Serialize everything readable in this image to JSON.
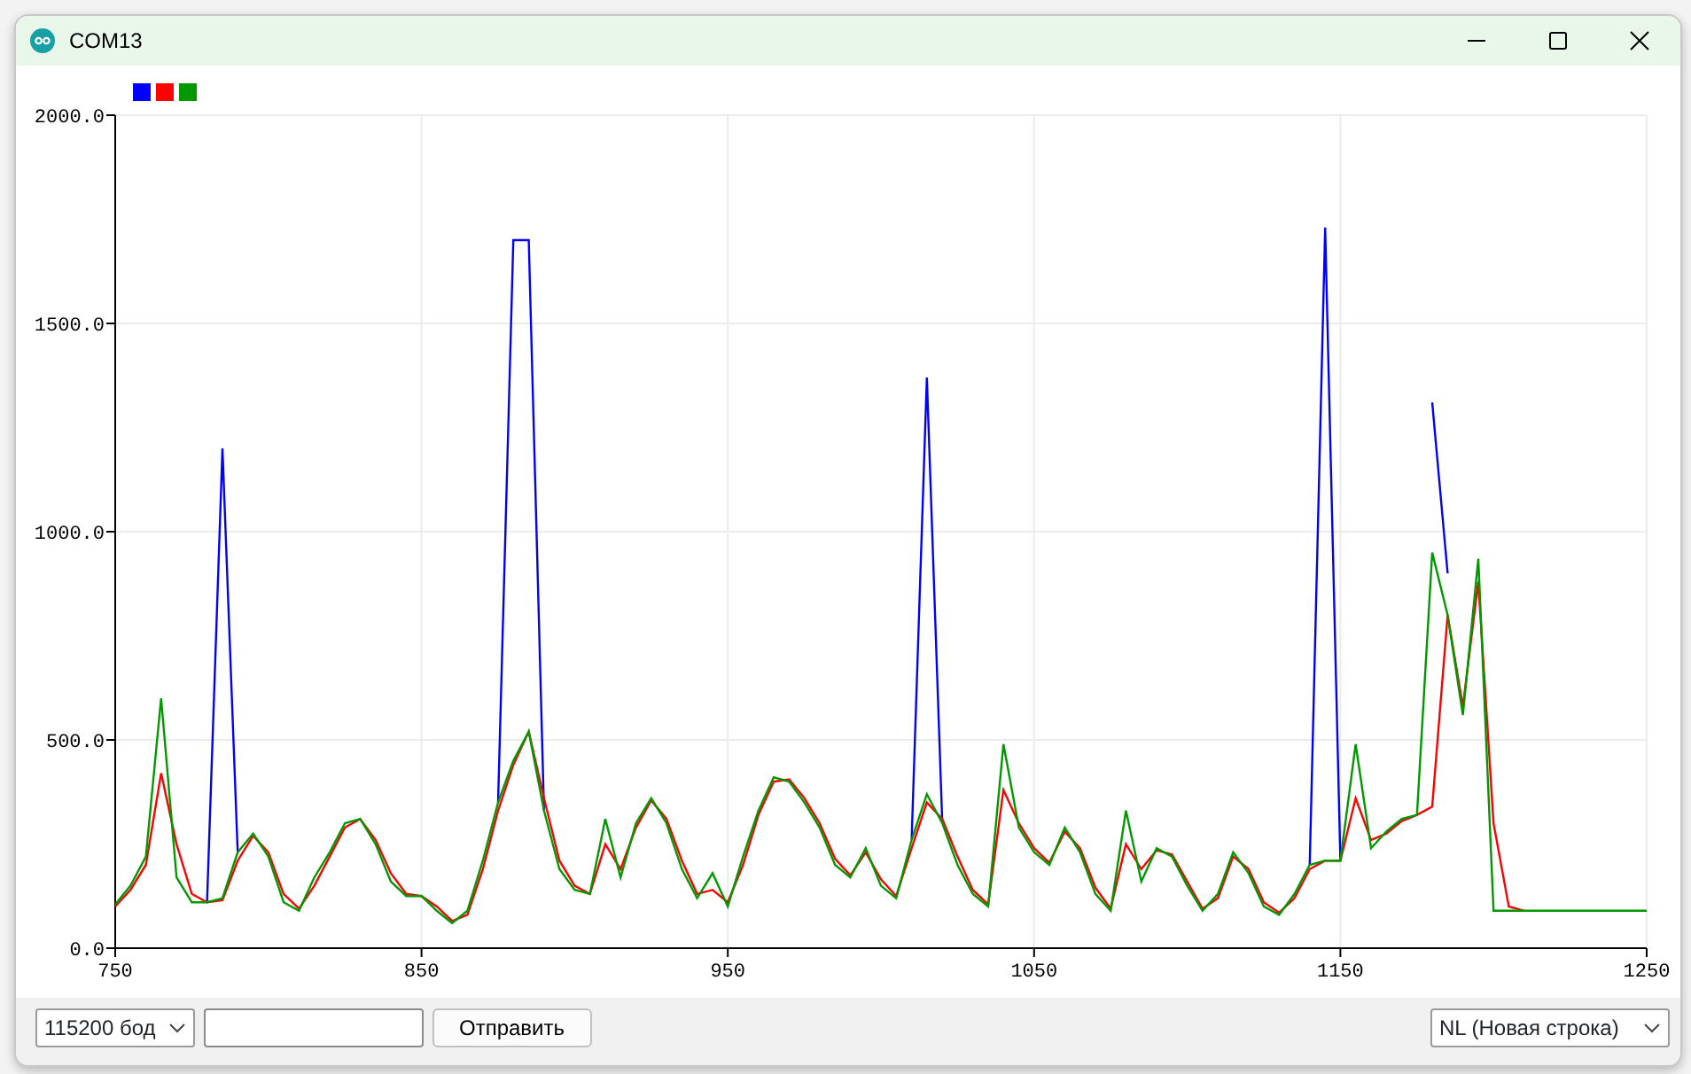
{
  "window": {
    "title": "COM13"
  },
  "plotter": {
    "chart_data": {
      "type": "line",
      "grid": true,
      "xlim": [
        750,
        1250
      ],
      "ylim": [
        0,
        2000
      ],
      "xticks": [
        750,
        850,
        950,
        1050,
        1150,
        1250
      ],
      "yticks": [
        {
          "value": 0,
          "label": "0.0"
        },
        {
          "value": 500,
          "label": "500.0"
        },
        {
          "value": 1000,
          "label": "1000.0"
        },
        {
          "value": 1500,
          "label": "1500.0"
        },
        {
          "value": 2000,
          "label": "2000.0"
        }
      ],
      "x": [
        750,
        755,
        760,
        765,
        770,
        775,
        780,
        785,
        790,
        795,
        800,
        805,
        810,
        815,
        820,
        825,
        830,
        835,
        840,
        845,
        850,
        855,
        860,
        865,
        870,
        875,
        880,
        885,
        890,
        895,
        900,
        905,
        910,
        915,
        920,
        925,
        930,
        935,
        940,
        945,
        950,
        955,
        960,
        965,
        970,
        975,
        980,
        985,
        990,
        995,
        1000,
        1005,
        1010,
        1015,
        1020,
        1025,
        1030,
        1035,
        1040,
        1045,
        1050,
        1055,
        1060,
        1065,
        1070,
        1075,
        1080,
        1085,
        1090,
        1095,
        1100,
        1105,
        1110,
        1115,
        1120,
        1125,
        1130,
        1135,
        1140,
        1145,
        1150,
        1155,
        1160,
        1165,
        1170,
        1175,
        1180,
        1185,
        1190,
        1195,
        1200,
        1205,
        1210,
        1215,
        1220,
        1225,
        1230,
        1235,
        1240,
        1245,
        1250
      ],
      "series": [
        {
          "color": "#0000ff",
          "values": [
            null,
            null,
            null,
            null,
            null,
            null,
            110,
            1200,
            230,
            null,
            null,
            null,
            null,
            null,
            null,
            null,
            null,
            null,
            null,
            null,
            null,
            null,
            null,
            null,
            null,
            350,
            1700,
            1700,
            330,
            null,
            null,
            null,
            null,
            null,
            null,
            null,
            null,
            null,
            null,
            null,
            null,
            null,
            null,
            null,
            null,
            null,
            null,
            null,
            null,
            null,
            null,
            null,
            260,
            1370,
            300,
            null,
            null,
            null,
            null,
            null,
            null,
            null,
            null,
            null,
            null,
            null,
            null,
            null,
            null,
            null,
            null,
            null,
            null,
            null,
            null,
            null,
            null,
            null,
            200,
            1730,
            210,
            null,
            null,
            null,
            null,
            null,
            1310,
            900,
            null,
            null,
            null,
            null,
            null,
            null,
            null,
            null,
            null,
            null,
            null,
            null,
            null
          ]
        },
        {
          "color": "#ff0000",
          "values": [
            100,
            140,
            200,
            420,
            250,
            130,
            110,
            115,
            210,
            270,
            230,
            130,
            95,
            150,
            220,
            290,
            310,
            260,
            180,
            130,
            125,
            100,
            65,
            80,
            190,
            330,
            440,
            520,
            360,
            210,
            150,
            130,
            250,
            190,
            290,
            355,
            310,
            210,
            130,
            140,
            110,
            200,
            320,
            400,
            405,
            360,
            300,
            215,
            175,
            230,
            165,
            125,
            240,
            350,
            310,
            220,
            140,
            105,
            380,
            300,
            240,
            205,
            280,
            240,
            145,
            95,
            250,
            190,
            235,
            225,
            160,
            95,
            120,
            220,
            190,
            110,
            85,
            120,
            190,
            210,
            210,
            360,
            260,
            275,
            305,
            320,
            340,
            800,
            580,
            880,
            300,
            100,
            90,
            null,
            null,
            null,
            null,
            null,
            null,
            null,
            null
          ]
        },
        {
          "color": "#009900",
          "values": [
            105,
            150,
            220,
            600,
            170,
            110,
            110,
            120,
            230,
            275,
            220,
            110,
            90,
            170,
            230,
            300,
            310,
            250,
            160,
            125,
            125,
            90,
            60,
            90,
            210,
            350,
            450,
            520,
            330,
            190,
            140,
            130,
            310,
            170,
            300,
            360,
            300,
            190,
            120,
            180,
            100,
            220,
            330,
            410,
            400,
            350,
            290,
            200,
            170,
            240,
            150,
            120,
            260,
            370,
            300,
            200,
            130,
            100,
            490,
            290,
            230,
            200,
            290,
            230,
            130,
            90,
            330,
            160,
            240,
            220,
            150,
            90,
            130,
            230,
            180,
            100,
            80,
            130,
            200,
            210,
            210,
            490,
            240,
            280,
            310,
            320,
            950,
            800,
            560,
            935,
            90,
            90,
            90,
            90,
            90,
            90,
            90,
            90,
            90,
            90,
            90
          ]
        }
      ]
    }
  },
  "footer": {
    "baud": "115200 бод",
    "send_button": "Отправить",
    "line_ending": "NL (Новая строка)"
  }
}
